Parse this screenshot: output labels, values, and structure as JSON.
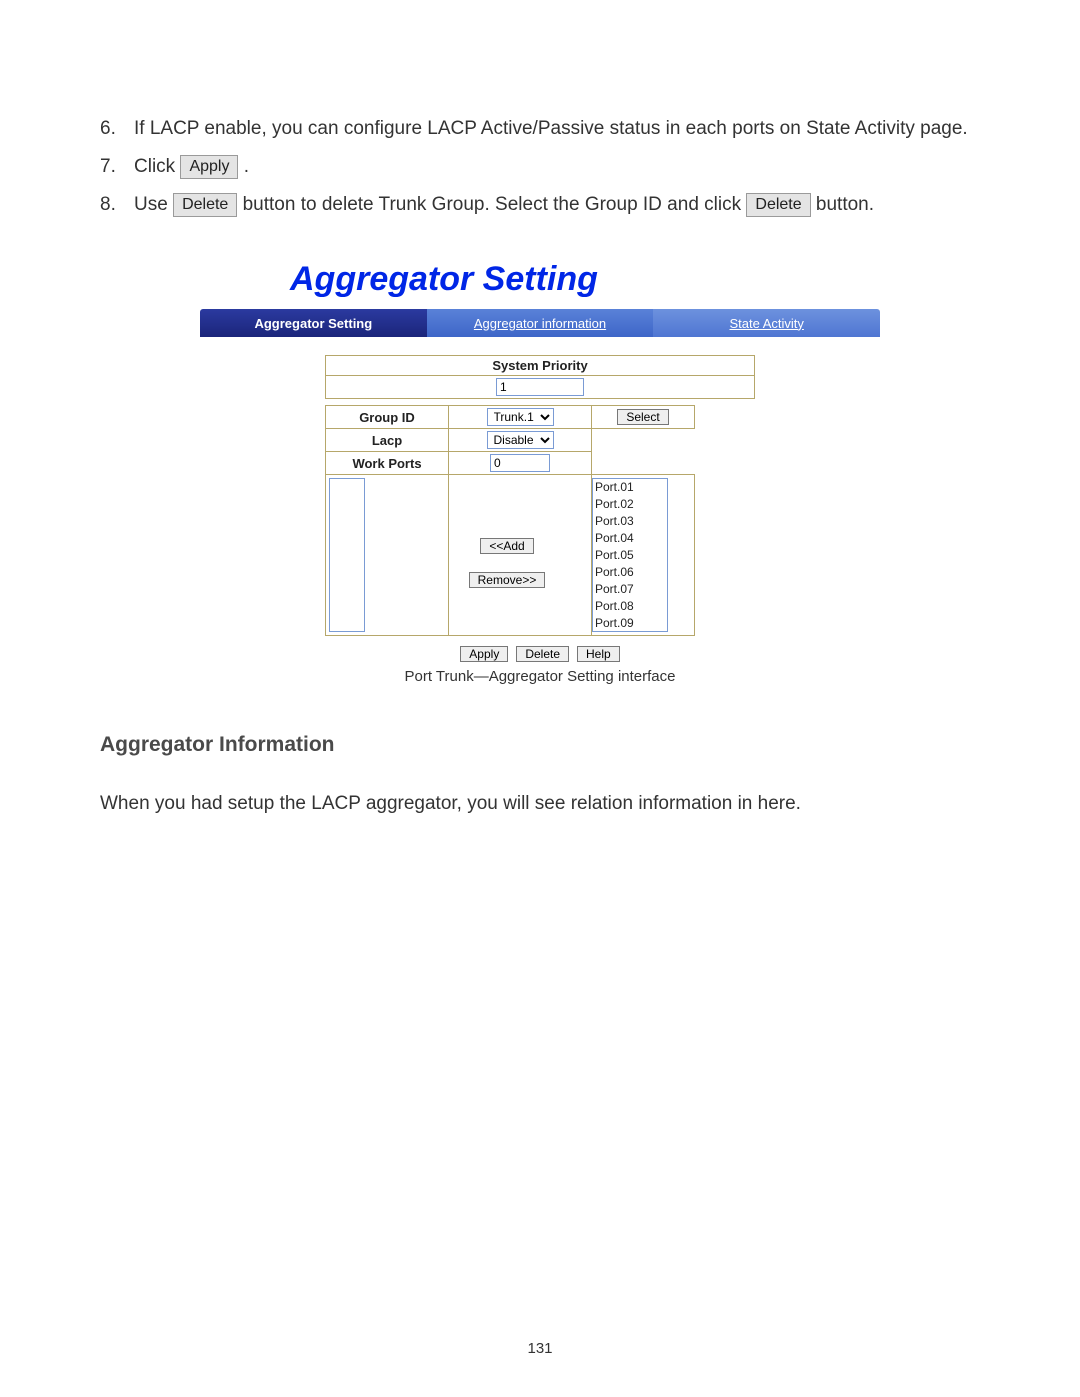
{
  "steps": {
    "s6": {
      "num": "6.",
      "text": "If LACP enable, you can configure LACP Active/Passive status in each ports on State Activity page."
    },
    "s7": {
      "num": "7.",
      "pre": "Click",
      "btn": "Apply",
      "post": "."
    },
    "s8": {
      "num": "8.",
      "pre": "Use ",
      "btn1": "Delete",
      "mid": " button to delete Trunk Group. Select the Group ID and click ",
      "btn2": "Delete",
      "post": " button."
    }
  },
  "shot": {
    "title": "Aggregator Setting",
    "tabs": {
      "t1": "Aggregator Setting",
      "t2": "Aggregator information",
      "t3": "State Activity"
    },
    "sys_priority_label": "System Priority",
    "sys_priority_value": "1",
    "rows": {
      "group_id": "Group ID",
      "lacp": "Lacp",
      "work_ports": "Work Ports"
    },
    "group_id_value": "Trunk.1",
    "lacp_value": "Disable",
    "work_ports_value": "0",
    "select_btn": "Select",
    "add_btn": "<<Add",
    "remove_btn": "Remove>>",
    "ports": [
      "Port.01",
      "Port.02",
      "Port.03",
      "Port.04",
      "Port.05",
      "Port.06",
      "Port.07",
      "Port.08",
      "Port.09"
    ],
    "apply": "Apply",
    "delete": "Delete",
    "help": "Help",
    "caption": "Port Trunk—Aggregator Setting interface"
  },
  "section_heading": "Aggregator Information",
  "section_body": "When you had setup the LACP aggregator, you will see relation information in here.",
  "page_number": "131"
}
